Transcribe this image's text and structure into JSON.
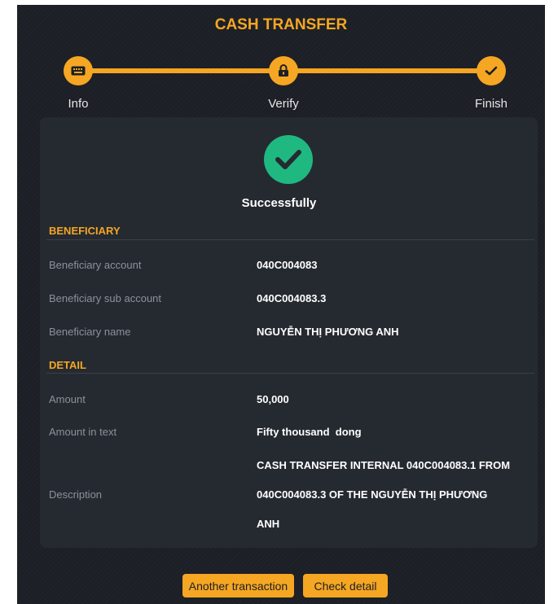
{
  "title": "CASH TRANSFER",
  "steps": [
    {
      "label": "Info",
      "icon": "keyboard-icon"
    },
    {
      "label": "Verify",
      "icon": "lock-icon"
    },
    {
      "label": "Finish",
      "icon": "check-icon"
    }
  ],
  "status": {
    "text": "Successfully",
    "icon": "success-check-icon"
  },
  "beneficiary": {
    "heading": "BENEFICIARY",
    "rows": [
      {
        "label": "Beneficiary account",
        "value": "040C004083"
      },
      {
        "label": "Beneficiary sub account",
        "value": "040C004083.3"
      },
      {
        "label": "Beneficiary name",
        "value": "NGUYỄN THỊ PHƯƠNG ANH"
      }
    ]
  },
  "detail": {
    "heading": "DETAIL",
    "rows": [
      {
        "label": "Amount",
        "value": "50,000"
      },
      {
        "label": "Amount in text",
        "value": "Fifty thousand  dong"
      }
    ],
    "description": {
      "label": "Description",
      "lines": [
        "CASH TRANSFER INTERNAL 040C004083.1 FROM",
        "040C004083.3 OF THE NGUYỄN THỊ PHƯƠNG",
        "ANH"
      ]
    }
  },
  "buttons": {
    "another": "Another transaction",
    "check": "Check detail"
  },
  "colors": {
    "accent": "#f5a623",
    "success": "#1fb881",
    "panel": "#1c1f25",
    "card": "#252a31"
  }
}
